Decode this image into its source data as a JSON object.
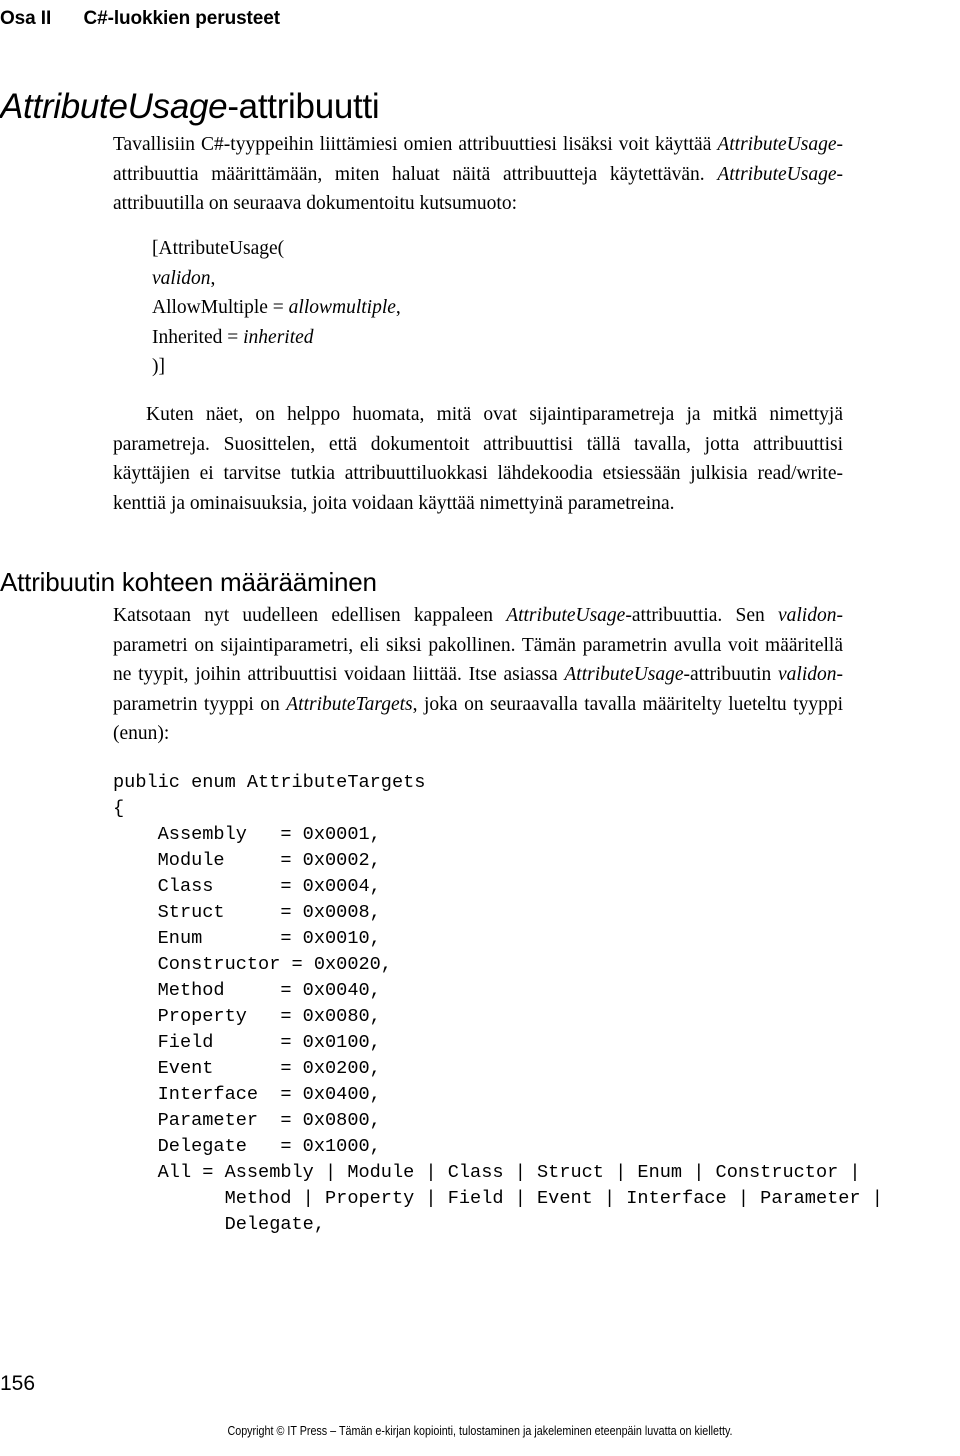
{
  "running_head": {
    "part": "Osa II",
    "chapter": "C#-luokkien perusteet"
  },
  "page_title": {
    "italic_part": "AttributeUsage",
    "rest": "-attribuutti"
  },
  "paragraphs": {
    "intro_1": "Tavallisiin C#-tyyppeihin liittämiesi omien attribuuttiesi lisäksi voit käyttää ",
    "intro_1_ital_a": "AttributeUsage",
    "intro_1_b": "-attribuuttia määrittämään, miten haluat näitä attribuutteja käytettävän.  ",
    "intro_1_ital_b": "AttributeUsage",
    "intro_1_c": "-attribuutilla on seuraava dokumentoitu kutsumuoto:",
    "after_sig_a": "Kuten näet, on helppo huomata, mitä ovat sijaintiparametreja ja mitkä nimettyjä parametreja. Suosittelen, että dokumentoit attribuuttisi tällä tavalla, jotta attribuuttisi käyttäjien ei tarvitse tutkia attribuuttiluokkasi lähdekoodia etsiessään julkisia read/write-kenttiä ja ominaisuuksia, joita voidaan käyttää nimettyinä parametreina.",
    "section_body_1": "Katsotaan nyt uudelleen edellisen kappaleen ",
    "section_body_ital_1": "AttributeUsage",
    "section_body_2": "-attribuuttia. Sen ",
    "section_body_ital_2": "validon",
    "section_body_3": "-parametri on sijaintiparametri, eli siksi pakollinen. Tämän parametrin avulla voit määritellä ne tyypit, joihin attribuuttisi voidaan liittää. Itse asiassa ",
    "section_body_ital_3": "AttributeUsage",
    "section_body_4": "-attribuutin ",
    "section_body_ital_4": "validon",
    "section_body_5": "-parametrin tyyppi on ",
    "section_body_ital_5": "AttributeTargets",
    "section_body_6": ", joka on seuraavalla tavalla määritelty lueteltu tyyppi (enun):"
  },
  "signature_block": {
    "line_1": "[AttributeUsage(",
    "line_2_ital": "validon",
    "line_2_rest": ",",
    "line_3_pre": "AllowMultiple = ",
    "line_3_ital": "allowmultiple",
    "line_3_rest": ",",
    "line_4_pre": "Inherited = ",
    "line_4_ital": "inherited",
    "line_5": ")]"
  },
  "section_heading": "Attribuutin kohteen määrääminen",
  "code_block": "public enum AttributeTargets\n{\n    Assembly   = 0x0001,\n    Module     = 0x0002,\n    Class      = 0x0004,\n    Struct     = 0x0008,\n    Enum       = 0x0010,\n    Constructor = 0x0020,\n    Method     = 0x0040,\n    Property   = 0x0080,\n    Field      = 0x0100,\n    Event      = 0x0200,\n    Interface  = 0x0400,\n    Parameter  = 0x0800,\n    Delegate   = 0x1000,\n    All = Assembly | Module | Class | Struct | Enum | Constructor |\n          Method | Property | Field | Event | Interface | Parameter |\n          Delegate,",
  "code_data": {
    "declaration": "public enum AttributeTargets",
    "open_brace": "{",
    "members": [
      {
        "name": "Assembly",
        "value": "0x0001"
      },
      {
        "name": "Module",
        "value": "0x0002"
      },
      {
        "name": "Class",
        "value": "0x0004"
      },
      {
        "name": "Struct",
        "value": "0x0008"
      },
      {
        "name": "Enum",
        "value": "0x0010"
      },
      {
        "name": "Constructor",
        "value": "0x0020"
      },
      {
        "name": "Method",
        "value": "0x0040"
      },
      {
        "name": "Property",
        "value": "0x0080"
      },
      {
        "name": "Field",
        "value": "0x0100"
      },
      {
        "name": "Event",
        "value": "0x0200"
      },
      {
        "name": "Interface",
        "value": "0x0400"
      },
      {
        "name": "Parameter",
        "value": "0x0800"
      },
      {
        "name": "Delegate",
        "value": "0x1000"
      }
    ],
    "all_member": {
      "name": "All",
      "value": "Assembly | Module | Class | Struct | Enum | Constructor | Method | Property | Field | Event | Interface | Parameter | Delegate,"
    }
  },
  "footer": {
    "page_number": "156",
    "copyright": "Copyright © IT Press – Tämän e-kirjan kopiointi, tulostaminen ja jakeleminen eteenpäin luvatta on kielletty."
  },
  "colors": {
    "text": "#000000",
    "background": "#ffffff"
  }
}
